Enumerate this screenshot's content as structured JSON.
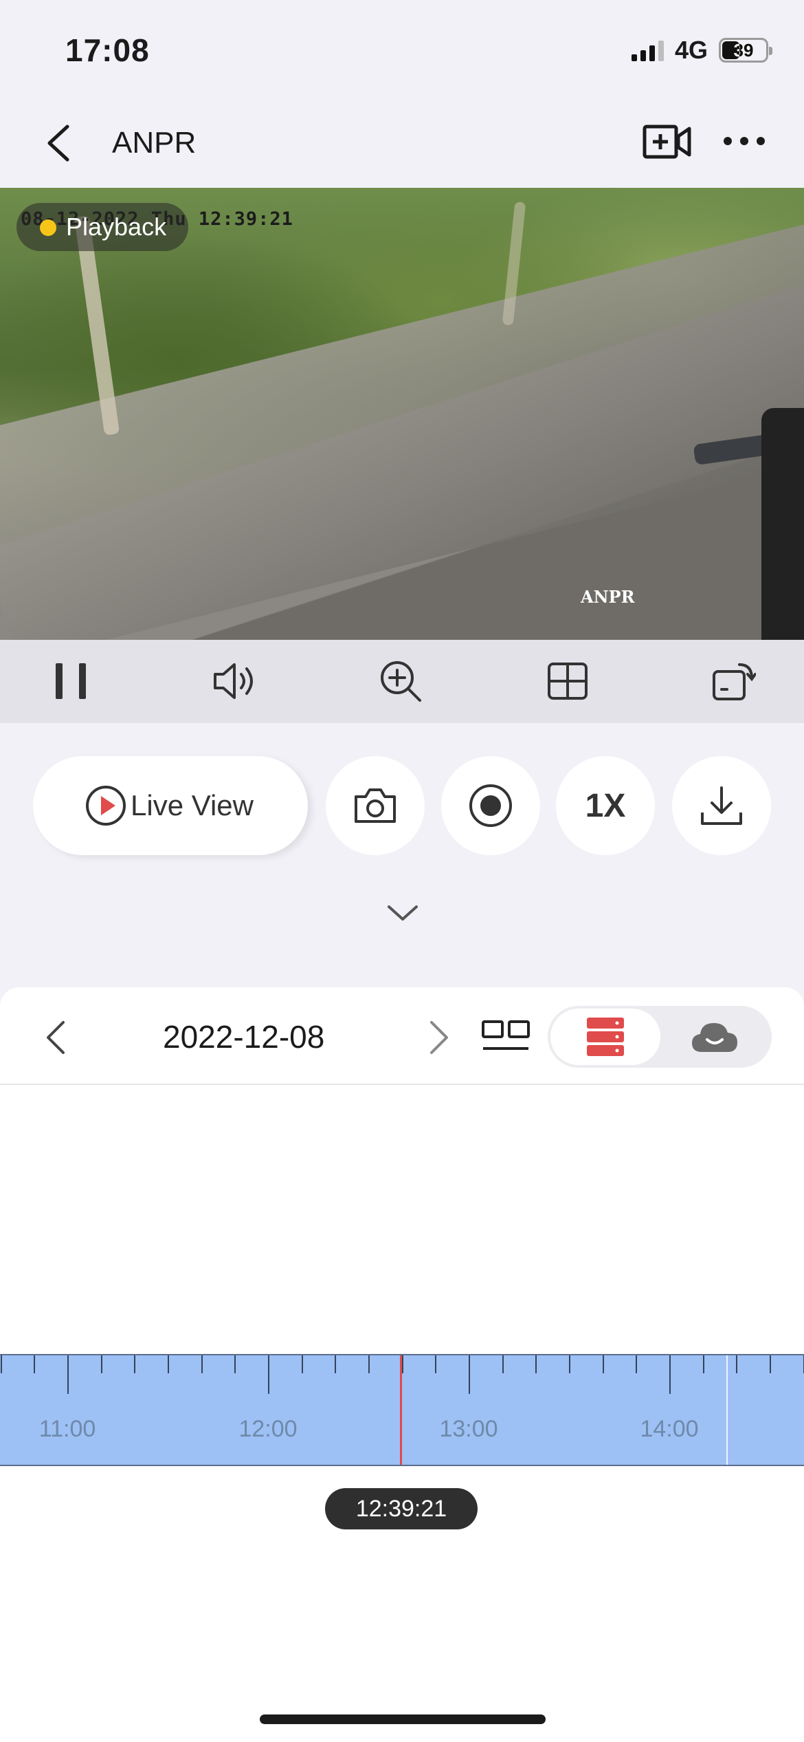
{
  "status_bar": {
    "time": "17:08",
    "network": "4G",
    "battery": "39"
  },
  "nav": {
    "title": "ANPR"
  },
  "video": {
    "osd_time": "08-12-2022 Thu 12:39:21",
    "osd_name": "ANPR",
    "playback_label": "Playback"
  },
  "toolbar": {
    "icons": [
      "pause-icon",
      "volume-icon",
      "zoom-in-icon",
      "grid-layout-icon",
      "rotate-screen-icon"
    ]
  },
  "actions": {
    "live_view_label": "Live View",
    "speed_label": "1X"
  },
  "date_bar": {
    "date": "2022-12-08"
  },
  "timeline": {
    "labels": [
      "11:00",
      "12:00",
      "13:00",
      "14:00"
    ],
    "current_time": "12:39:21"
  },
  "colors": {
    "accent_red": "#e04b4b",
    "timeline_blue": "#9dc0f5",
    "playback_dot": "#f5c518"
  }
}
